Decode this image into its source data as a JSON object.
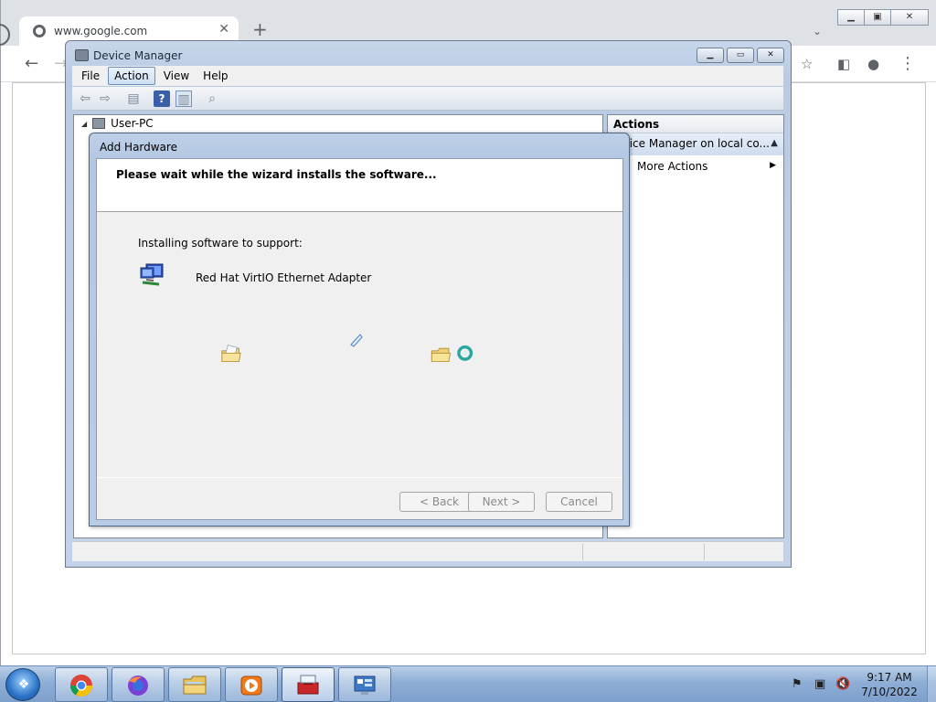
{
  "browser": {
    "tab_title": "www.google.com",
    "tab_close": "✕",
    "new_tab": "+",
    "tab_list": "⌄"
  },
  "device_manager": {
    "title": "Device Manager",
    "menu": [
      "File",
      "Action",
      "View",
      "Help"
    ],
    "tree_root": "User-PC",
    "actions_header": "Actions",
    "actions_section": "Device Manager on local co...",
    "more_actions": "More Actions"
  },
  "wizard": {
    "title": "Add Hardware",
    "heading": "Please wait while the wizard installs the software...",
    "installing_label": "Installing software to support:",
    "device_name": "Red Hat VirtIO Ethernet Adapter",
    "back_button": "< Back",
    "next_button": "Next >",
    "cancel_button": "Cancel"
  },
  "taskbar": {
    "apps": [
      "chrome-icon",
      "firefox-icon",
      "file-explorer-icon",
      "media-player-icon",
      "toolbox-icon",
      "remote-desktop-icon"
    ],
    "clock_time": "9:17 AM",
    "clock_date": "7/10/2022"
  },
  "colors": {
    "title_bar": "#b9cbe3",
    "taskbar": "#8eaed6",
    "wizard_header": "#ffffff"
  }
}
